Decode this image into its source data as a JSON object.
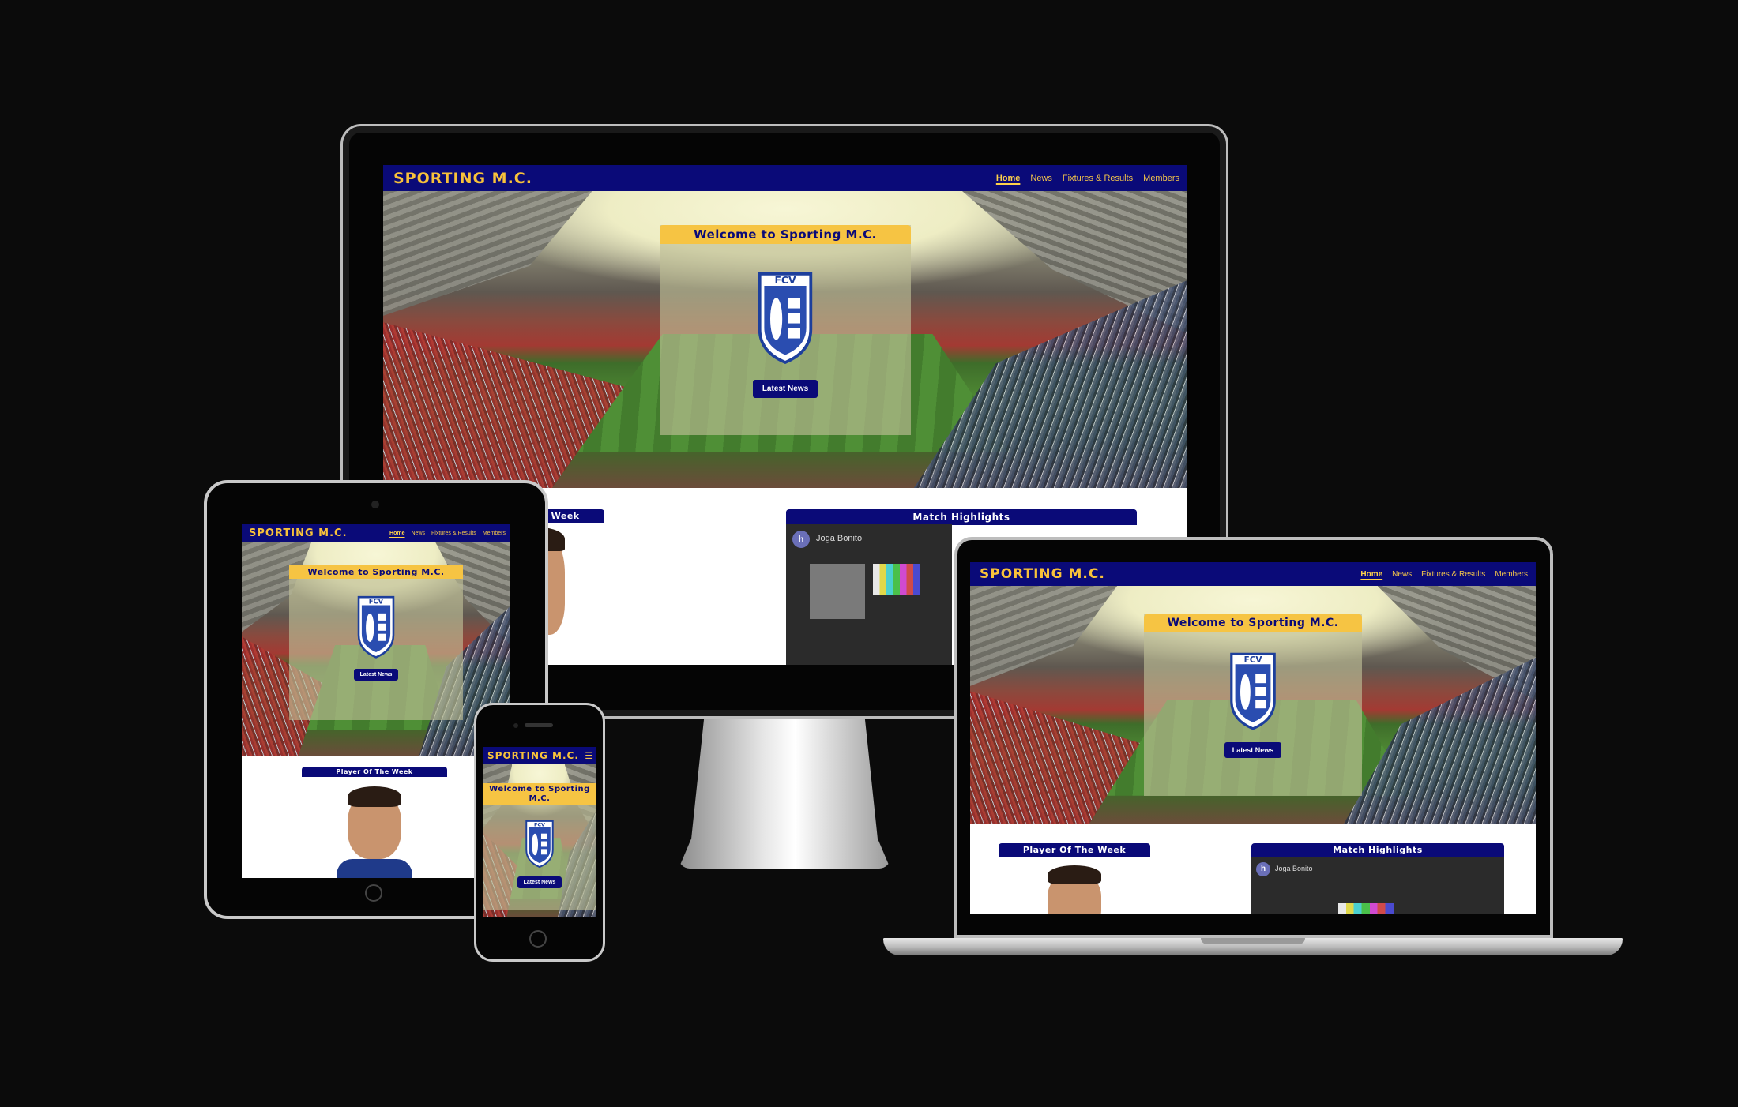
{
  "site": {
    "brand": "SPORTING M.C.",
    "nav": [
      "Home",
      "News",
      "Fixtures & Results",
      "Members"
    ],
    "menu_icon": "hamburger-icon",
    "welcome_title": "Welcome to Sporting M.C.",
    "welcome_title_mobile_line1": "Welcome to Sporting",
    "welcome_title_mobile_line2": "M.C.",
    "crest_text": "FCV",
    "cta_label": "Latest News",
    "player_section_title": "Player Of The Week",
    "player_section_title_partial": "he Week",
    "highlights_section_title": "Match Highlights",
    "video_channel_initial": "h",
    "video_title": "Joga Bonito"
  },
  "colors": {
    "navy": "#0a0a78",
    "gold": "#f6c443",
    "background": "#0b0b0b"
  },
  "devices": [
    "desktop-monitor",
    "tablet",
    "laptop",
    "smartphone"
  ]
}
